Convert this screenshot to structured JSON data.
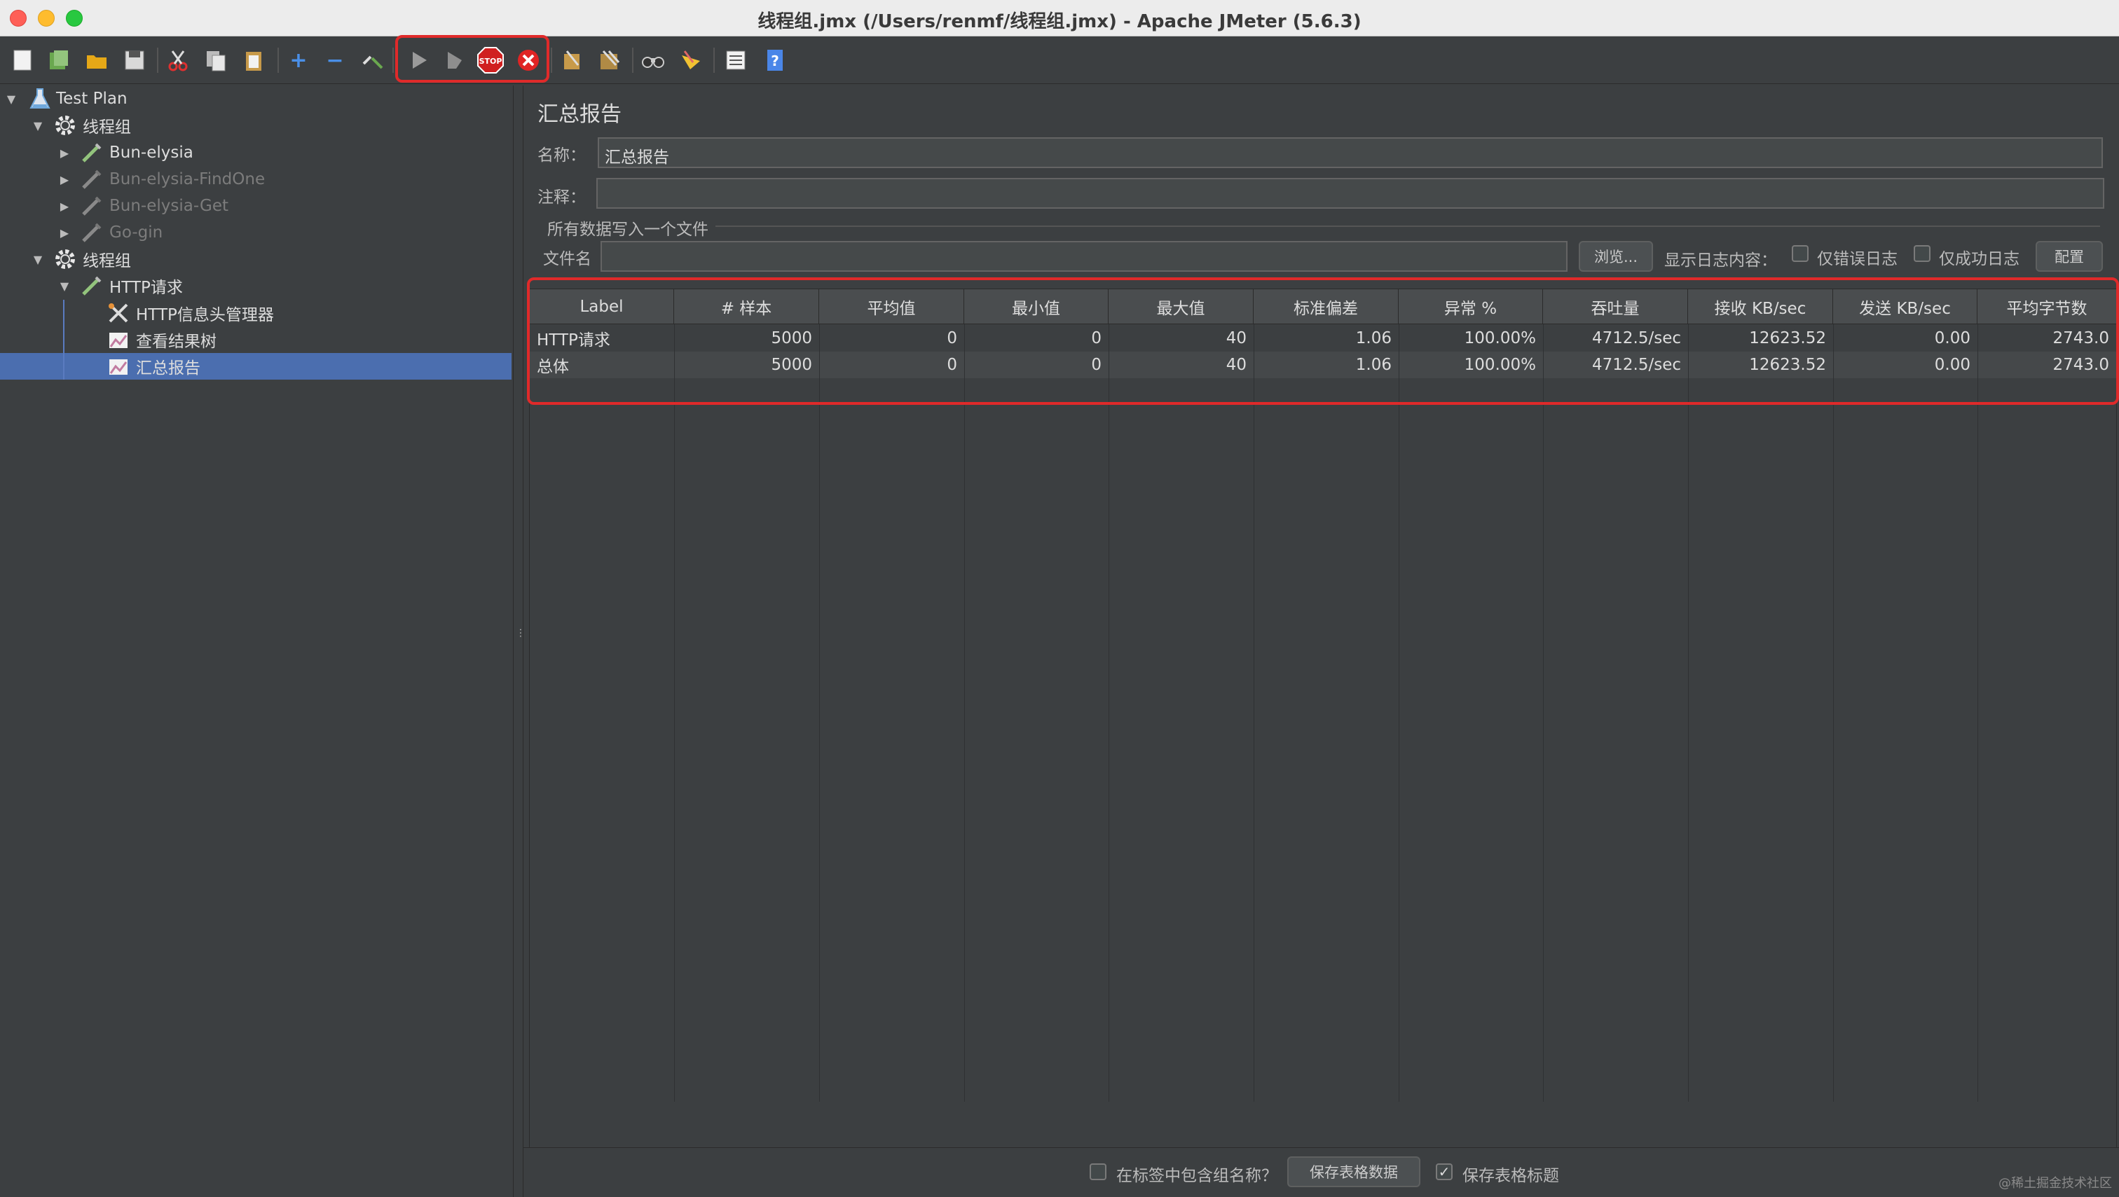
{
  "window": {
    "title": "线程组.jmx (/Users/renmf/线程组.jmx) - Apache JMeter (5.6.3)"
  },
  "toolbar": {
    "items": [
      "new",
      "templates",
      "open",
      "save",
      "cut",
      "copy",
      "paste",
      "expand",
      "collapse",
      "toggle",
      "start",
      "start-no-pauses",
      "stop",
      "shutdown",
      "clear",
      "clear-all",
      "search",
      "reset-search",
      "function-helper",
      "help"
    ],
    "stop_label": "STOP"
  },
  "tree": {
    "items": [
      {
        "label": "Test Plan",
        "icon": "flask-icon"
      },
      {
        "label": "线程组",
        "icon": "gear-icon"
      },
      {
        "label": "Bun-elysia",
        "icon": "pipette-icon"
      },
      {
        "label": "Bun-elysia-FindOne",
        "icon": "pipette-icon",
        "disabled": true
      },
      {
        "label": "Bun-elysia-Get",
        "icon": "pipette-icon",
        "disabled": true
      },
      {
        "label": "Go-gin",
        "icon": "pipette-icon",
        "disabled": true
      },
      {
        "label": "线程组",
        "icon": "gear-icon"
      },
      {
        "label": "HTTP请求",
        "icon": "pipette-icon"
      },
      {
        "label": "HTTP信息头管理器",
        "icon": "tools-icon"
      },
      {
        "label": "查看结果树",
        "icon": "graph-icon"
      },
      {
        "label": "汇总报告",
        "icon": "graph-icon",
        "selected": true
      }
    ]
  },
  "panel": {
    "title": "汇总报告",
    "name_label": "名称：",
    "name_value": "汇总报告",
    "comment_label": "注释：",
    "comment_value": "",
    "file_group_label": "所有数据写入一个文件",
    "filename_label": "文件名",
    "filename_value": "",
    "browse_label": "浏览...",
    "log_label": "显示日志内容：",
    "errors_only_label": "仅错误日志",
    "success_only_label": "仅成功日志",
    "configure_label": "配置"
  },
  "table": {
    "headers": [
      "Label",
      "# 样本",
      "平均值",
      "最小值",
      "最大值",
      "标准偏差",
      "异常 %",
      "吞吐量",
      "接收 KB/sec",
      "发送 KB/sec",
      "平均字节数"
    ],
    "rows": [
      [
        "HTTP请求",
        "5000",
        "0",
        "0",
        "40",
        "1.06",
        "100.00%",
        "4712.5/sec",
        "12623.52",
        "0.00",
        "2743.0"
      ],
      [
        "总体",
        "5000",
        "0",
        "0",
        "40",
        "1.06",
        "100.00%",
        "4712.5/sec",
        "12623.52",
        "0.00",
        "2743.0"
      ]
    ]
  },
  "footer": {
    "include_group_label": "在标签中包含组名称？",
    "save_data_label": "保存表格数据",
    "save_header_label": "保存表格标题",
    "save_header_checked": true,
    "include_group_checked": false
  },
  "watermark": "@稀土掘金技术社区"
}
